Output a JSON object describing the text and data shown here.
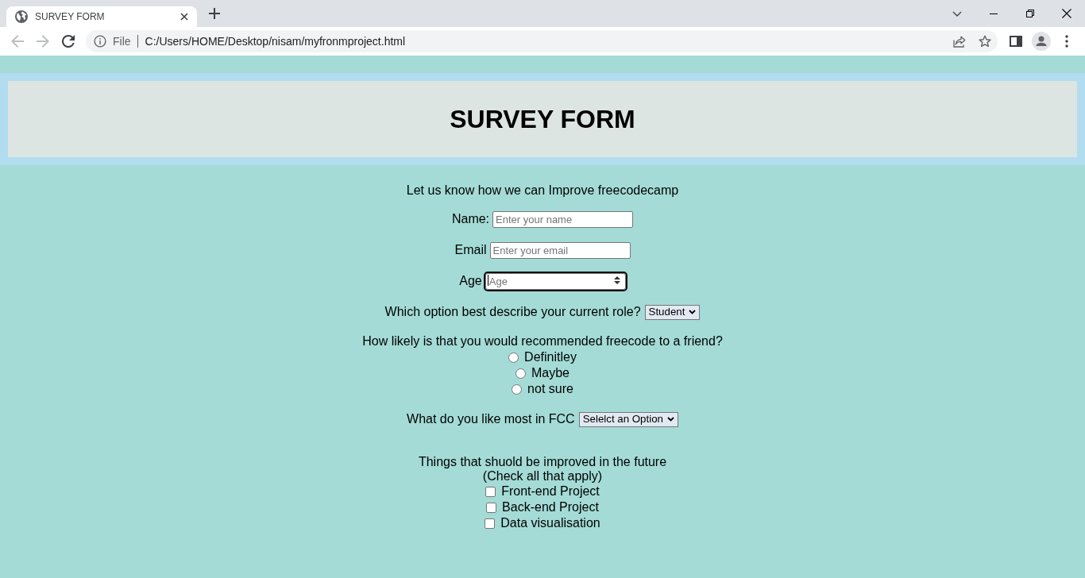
{
  "browser": {
    "tabs": [
      {
        "title": "SURVEY FORM",
        "selected": true
      }
    ],
    "back": {
      "disabled": true
    },
    "forward": {
      "disabled": true
    },
    "address_bar": {
      "scheme": "File",
      "url": "C:/Users/HOME/Desktop/nisam/myfronmproject.html"
    }
  },
  "page": {
    "title": "SURVEY FORM",
    "intro": "Let us know how we can Improve freecodecamp",
    "fields": [
      {
        "kind": "text",
        "label": "Name:",
        "placeholder": "Enter your name",
        "focused": false
      },
      {
        "kind": "text",
        "label": "Email",
        "placeholder": "Enter your email",
        "focused": false
      },
      {
        "kind": "number",
        "label": "Age",
        "placeholder": "Age",
        "focused": true
      },
      {
        "kind": "select",
        "label": "Which option best describe your current role?",
        "value": "Student",
        "focused": false
      }
    ],
    "recommend": {
      "question": "How likely is that you would recommended freecode to a friend?",
      "options": [
        {
          "label": "Definitley",
          "selected": false
        },
        {
          "label": "Maybe",
          "selected": false
        },
        {
          "label": "not sure",
          "selected": false
        }
      ]
    },
    "favorite": {
      "label": "What do you like most in FCC",
      "value": "Selelct an Option"
    },
    "improvements": {
      "question": "Things that shuold be improved in the future",
      "hint": "(Check all that apply)",
      "options": [
        {
          "label": "Front-end Project",
          "checked": false
        },
        {
          "label": "Back-end Project",
          "checked": false
        },
        {
          "label": "Data visualisation",
          "checked": false
        }
      ]
    }
  }
}
